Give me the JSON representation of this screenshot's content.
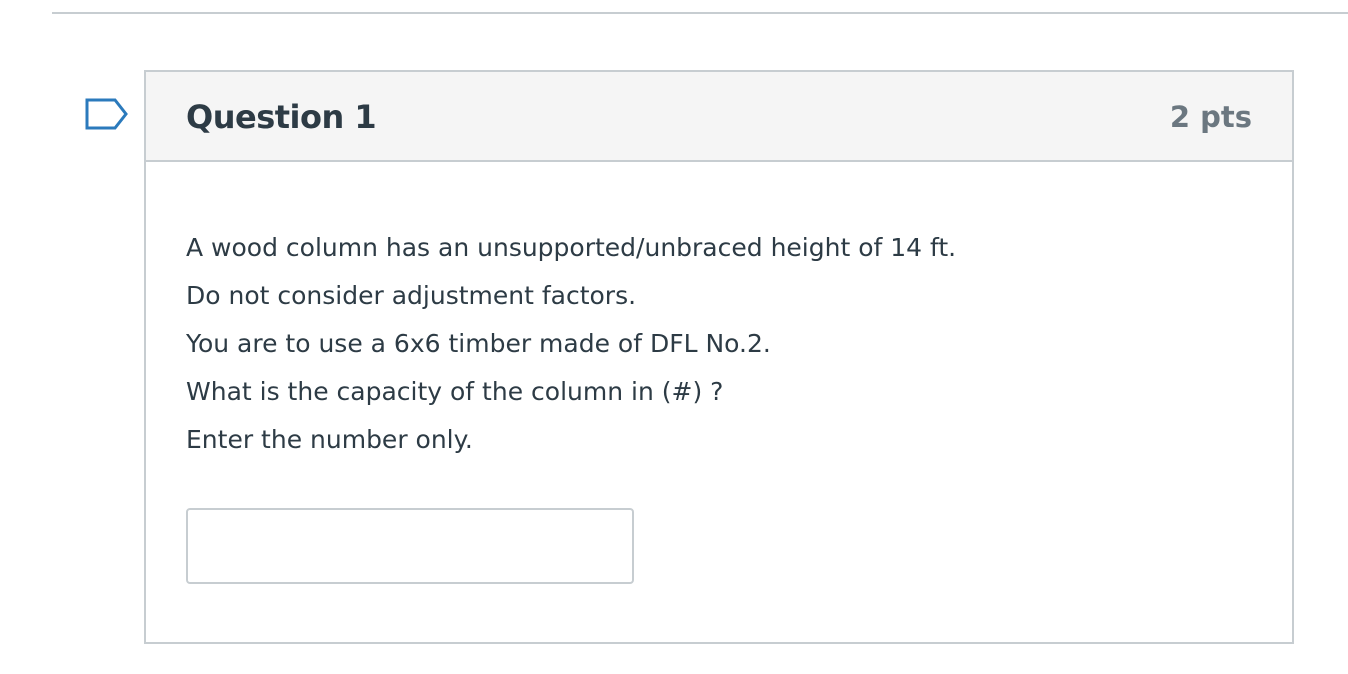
{
  "question": {
    "title": "Question 1",
    "points": "2 pts",
    "flag_icon": "bookmark-flag-icon",
    "body_lines": [
      "A wood column has an unsupported/unbraced height of 14 ft.",
      "Do not consider adjustment factors.",
      "You are to use a 6x6 timber made of DFL No.2.",
      "What is the capacity of the column in (#) ?",
      "Enter the number only."
    ],
    "answer": {
      "value": "",
      "placeholder": ""
    }
  },
  "colors": {
    "border": "#c7cdd1",
    "header_bg": "#f5f5f5",
    "text": "#2d3b45",
    "points_text": "#6b7780",
    "flag_stroke": "#2b7abc"
  }
}
